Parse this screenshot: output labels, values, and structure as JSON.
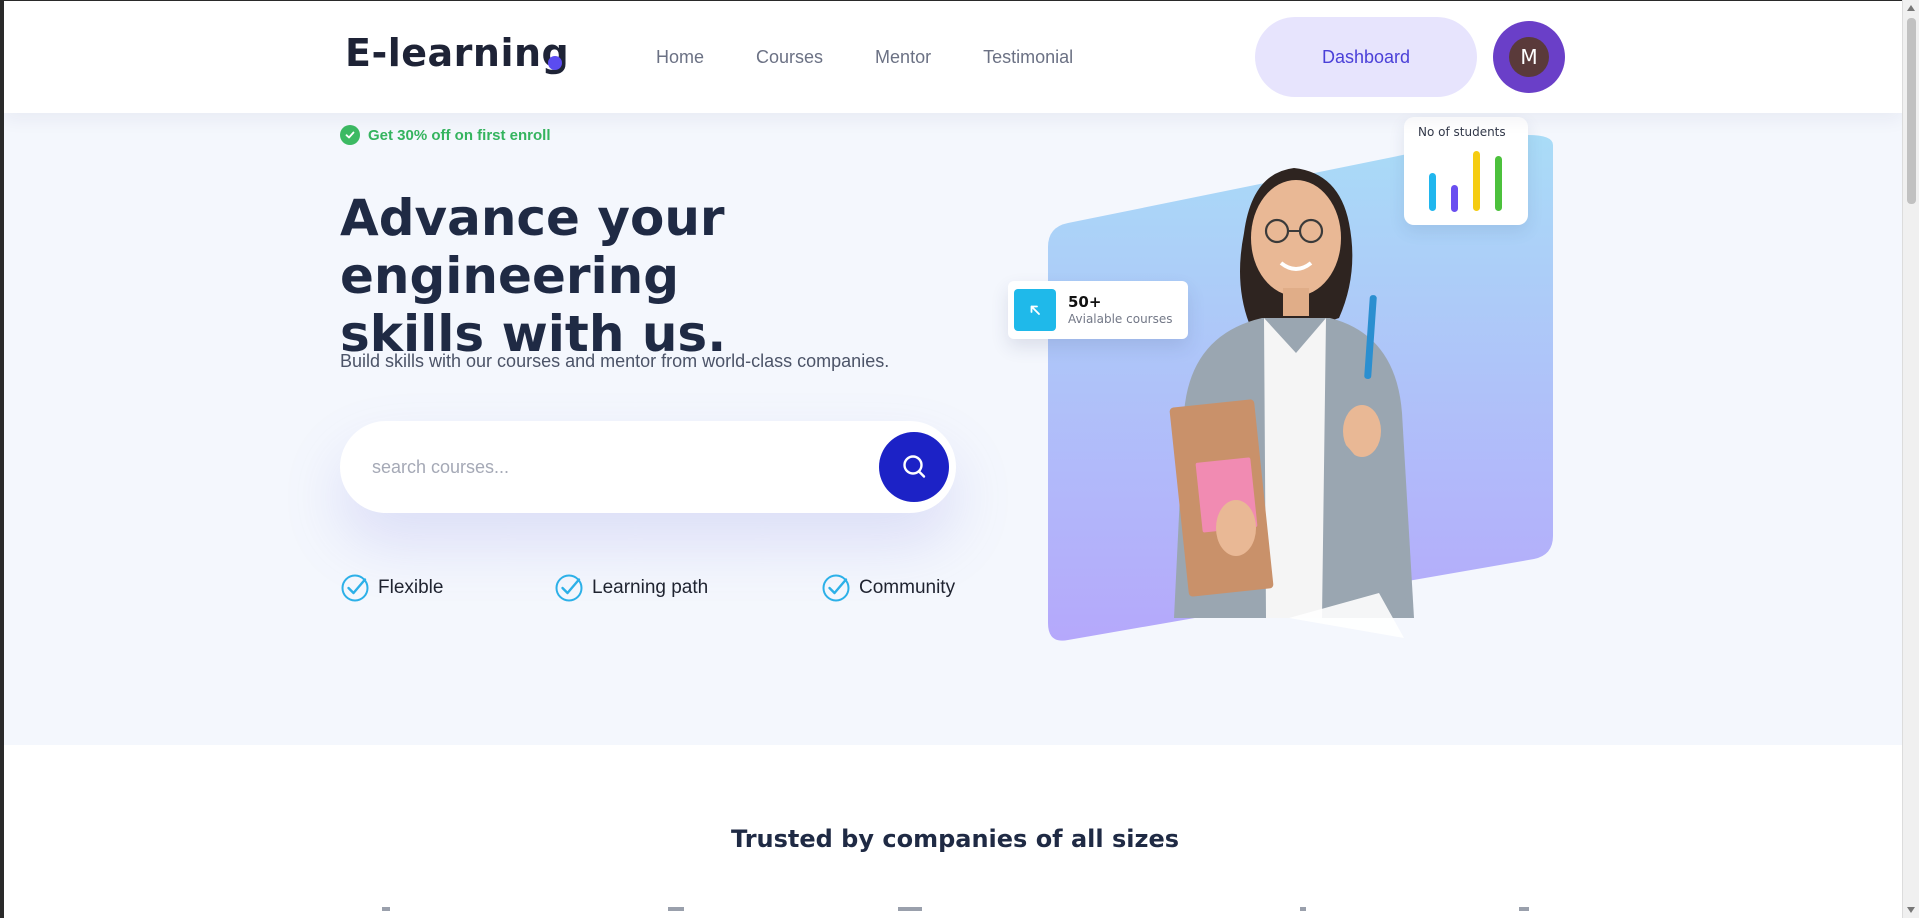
{
  "header": {
    "logo": "E-learning",
    "nav": [
      "Home",
      "Courses",
      "Mentor",
      "Testimonial"
    ],
    "dashboard_label": "Dashboard",
    "avatar_initial": "M"
  },
  "hero": {
    "promo": "Get 30% off on first enroll",
    "headline_line1": "Advance your engineering",
    "headline_line2": "skills with us.",
    "subtext": "Build skills with our courses and mentor from world-class companies.",
    "search_placeholder": "search courses...",
    "features": [
      "Flexible",
      "Learning path",
      "Community"
    ]
  },
  "visual": {
    "students_card_title": "No of students",
    "bar_colors": [
      "#20b6ee",
      "#6a4ff0",
      "#f5cc11",
      "#4cc13c"
    ],
    "courses_count": "50+",
    "courses_label": "Avialable courses"
  },
  "trusted": {
    "title": "Trusted by companies of all sizes"
  },
  "colors": {
    "accent": "#1c22c6",
    "promo_green": "#35b45f",
    "dashboard_bg": "#e7e4fd",
    "avatar_bg": "#6a3fc8"
  }
}
